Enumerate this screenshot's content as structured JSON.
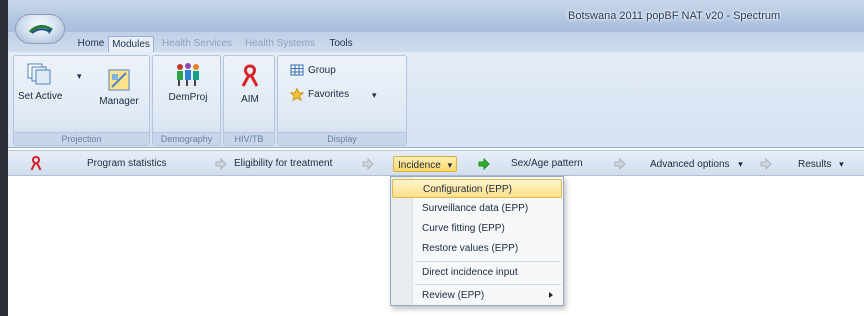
{
  "window": {
    "title": "Botswana 2011 popBF NAT v20 - Spectrum"
  },
  "ribbon_tabs": [
    {
      "label": "Home"
    },
    {
      "label": "Modules"
    },
    {
      "label": "Health Services"
    },
    {
      "label": "Health Systems"
    },
    {
      "label": "Tools"
    }
  ],
  "groups": {
    "projection": {
      "label": "Projection",
      "set_active": "Set Active",
      "manager": "Manager"
    },
    "demography": {
      "label": "Demography",
      "demproj": "DemProj"
    },
    "hivtb": {
      "label": "HIV/TB",
      "aim": "AIM"
    },
    "display": {
      "label": "Display",
      "group": "Group",
      "favorites": "Favorites"
    }
  },
  "navbar": {
    "items": [
      {
        "label": "Program statistics"
      },
      {
        "label": "Eligibility for treatment"
      },
      {
        "label": "Incidence"
      },
      {
        "label": "Sex/Age pattern"
      },
      {
        "label": "Advanced options"
      },
      {
        "label": "Results"
      }
    ]
  },
  "dropdown_menu": {
    "items": [
      {
        "label": "Configuration (EPP)"
      },
      {
        "label": "Surveillance data (EPP)"
      },
      {
        "label": "Curve fitting (EPP)"
      },
      {
        "label": "Restore values (EPP)"
      },
      {
        "label": "Direct incidence input"
      },
      {
        "label": "Review (EPP)"
      }
    ]
  },
  "colors": {
    "ribbon_bg": "#d6e2f2",
    "highlight": "#ffe08a",
    "aim_ribbon_red": "#d8232a",
    "green_arrow": "#2fb02f"
  }
}
